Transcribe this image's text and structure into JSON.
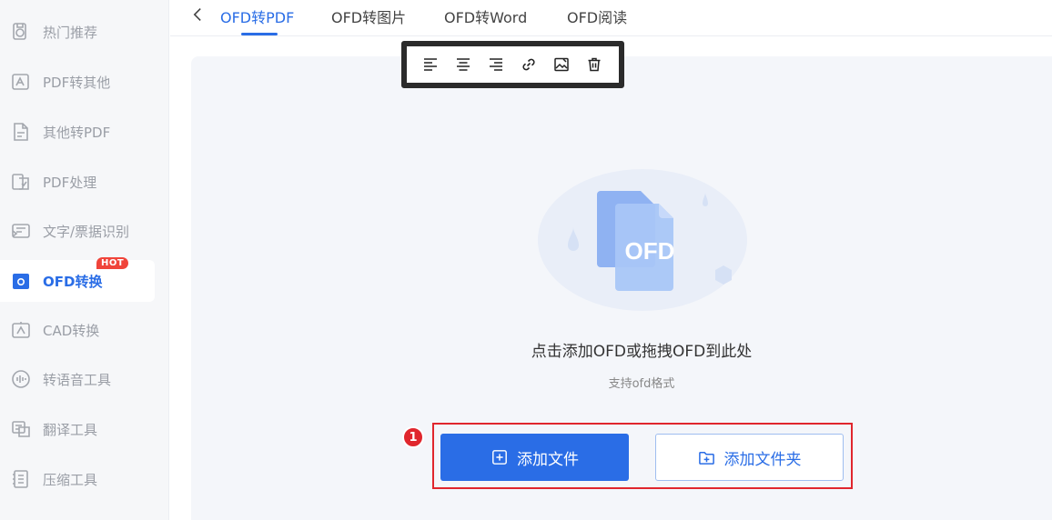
{
  "sidebar": {
    "items": [
      {
        "label": "热门推荐",
        "icon": "hot-recommend-icon"
      },
      {
        "label": "PDF转其他",
        "icon": "pdf-convert-icon"
      },
      {
        "label": "其他转PDF",
        "icon": "to-pdf-icon"
      },
      {
        "label": "PDF处理",
        "icon": "pdf-process-icon"
      },
      {
        "label": "文字/票据识别",
        "icon": "ocr-icon"
      },
      {
        "label": "OFD转换",
        "icon": "ofd-icon",
        "badge": "HOT",
        "active": true
      },
      {
        "label": "CAD转换",
        "icon": "cad-icon"
      },
      {
        "label": "转语音工具",
        "icon": "voice-icon"
      },
      {
        "label": "翻译工具",
        "icon": "translate-icon"
      },
      {
        "label": "压缩工具",
        "icon": "compress-icon"
      }
    ]
  },
  "tabs": [
    {
      "label": "OFD转PDF",
      "active": true
    },
    {
      "label": "OFD转图片"
    },
    {
      "label": "OFD转Word"
    },
    {
      "label": "OFD阅读"
    }
  ],
  "toolbar": {
    "icons": [
      "align-left-icon",
      "align-center-icon",
      "align-right-icon",
      "link-icon",
      "image-edit-icon",
      "trash-icon"
    ]
  },
  "dropzone": {
    "file_badge": "OFD",
    "title": "点击添加OFD或拖拽OFD到此处",
    "subtitle": "支持ofd格式",
    "add_file_label": "添加文件",
    "add_folder_label": "添加文件夹"
  },
  "annotation": {
    "step_number": "1"
  },
  "colors": {
    "accent": "#2a6de6",
    "highlight": "#e0262d",
    "hot_badge": "#f0443a"
  }
}
